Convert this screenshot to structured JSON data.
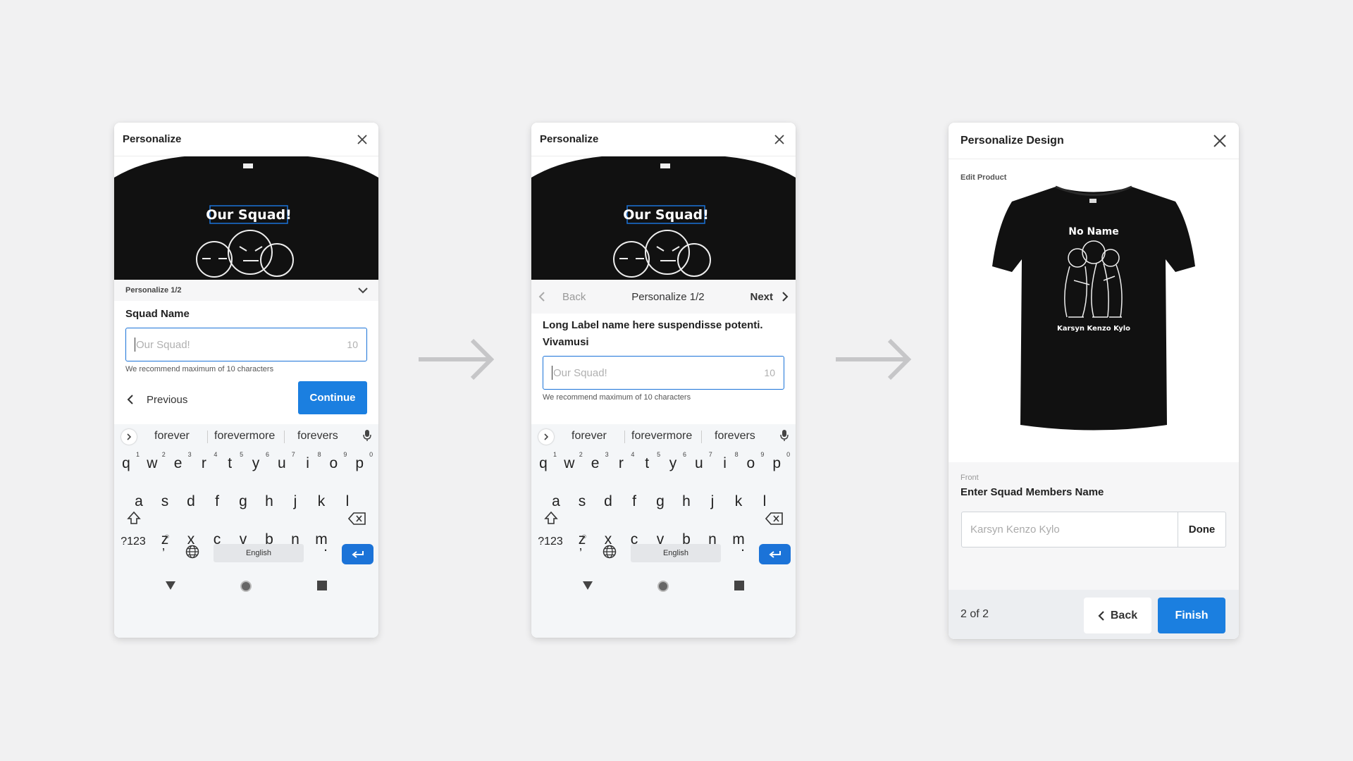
{
  "screens": [
    {
      "title": "Personalize",
      "shirt_text": "Our Squad!",
      "step_label": "Personalize 1/2",
      "field_label": "Squad Name",
      "input_placeholder": "Our Squad!",
      "char_count": "10",
      "hint": "We recommend maximum of 10 characters",
      "previous_label": "Previous",
      "continue_label": "Continue"
    },
    {
      "title": "Personalize",
      "shirt_text": "Our Squad!",
      "back_label": "Back",
      "step_label": "Personalize 1/2",
      "next_label": "Next",
      "field_label": "Long Label name here suspendisse potenti. Vivamusi",
      "input_placeholder": "Our Squad!",
      "char_count": "10",
      "hint": "We recommend maximum of 10 characters"
    },
    {
      "title": "Personalize Design",
      "edit_product": "Edit Product",
      "shirt_title": "No Name",
      "shirt_names": "Karsyn Kenzo Kylo",
      "section_label": "Front",
      "field_label": "Enter Squad Members Name",
      "input_placeholder": "Karsyn Kenzo Kylo",
      "done_label": "Done",
      "page_indicator": "2 of 2",
      "back_label": "Back",
      "finish_label": "Finish"
    }
  ],
  "keyboard": {
    "suggestions": [
      "forever",
      "forevermore",
      "forevers"
    ],
    "row1": [
      "q",
      "w",
      "e",
      "r",
      "t",
      "y",
      "u",
      "i",
      "o",
      "p"
    ],
    "row1_digits": [
      "1",
      "2",
      "3",
      "4",
      "5",
      "6",
      "7",
      "8",
      "9",
      "0"
    ],
    "row2": [
      "a",
      "s",
      "d",
      "f",
      "g",
      "h",
      "j",
      "k",
      "l"
    ],
    "row3": [
      "z",
      "x",
      "c",
      "v",
      "b",
      "n",
      "m"
    ],
    "symbols_key": "?123",
    "comma_key": ",",
    "space_label": "English",
    "period_key": "."
  },
  "colors": {
    "accent": "#1b7fe0",
    "background": "#f1f1f2",
    "shirt": "#111111"
  }
}
